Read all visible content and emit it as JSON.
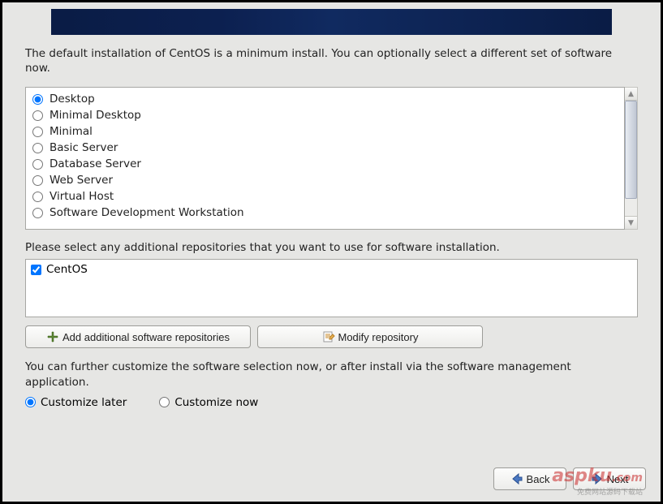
{
  "intro": "The default installation of CentOS is a minimum install. You can optionally select a different set of software now.",
  "software_options": [
    {
      "label": "Desktop",
      "selected": true
    },
    {
      "label": "Minimal Desktop",
      "selected": false
    },
    {
      "label": "Minimal",
      "selected": false
    },
    {
      "label": "Basic Server",
      "selected": false
    },
    {
      "label": "Database Server",
      "selected": false
    },
    {
      "label": "Web Server",
      "selected": false
    },
    {
      "label": "Virtual Host",
      "selected": false
    },
    {
      "label": "Software Development Workstation",
      "selected": false
    }
  ],
  "repo_label": "Please select any additional repositories that you want to use for software installation.",
  "repos": [
    {
      "label": "CentOS",
      "checked": true
    }
  ],
  "buttons": {
    "add_repo": "Add additional software repositories",
    "modify_repo": "Modify repository"
  },
  "customize_text": "You can further customize the software selection now, or after install via the software management application.",
  "customize": {
    "later": "Customize later",
    "now": "Customize now",
    "selected": "later"
  },
  "nav": {
    "back": "Back",
    "next": "Next"
  },
  "watermark": "aspku",
  "watermark_sub": "免费网站源码下载站"
}
